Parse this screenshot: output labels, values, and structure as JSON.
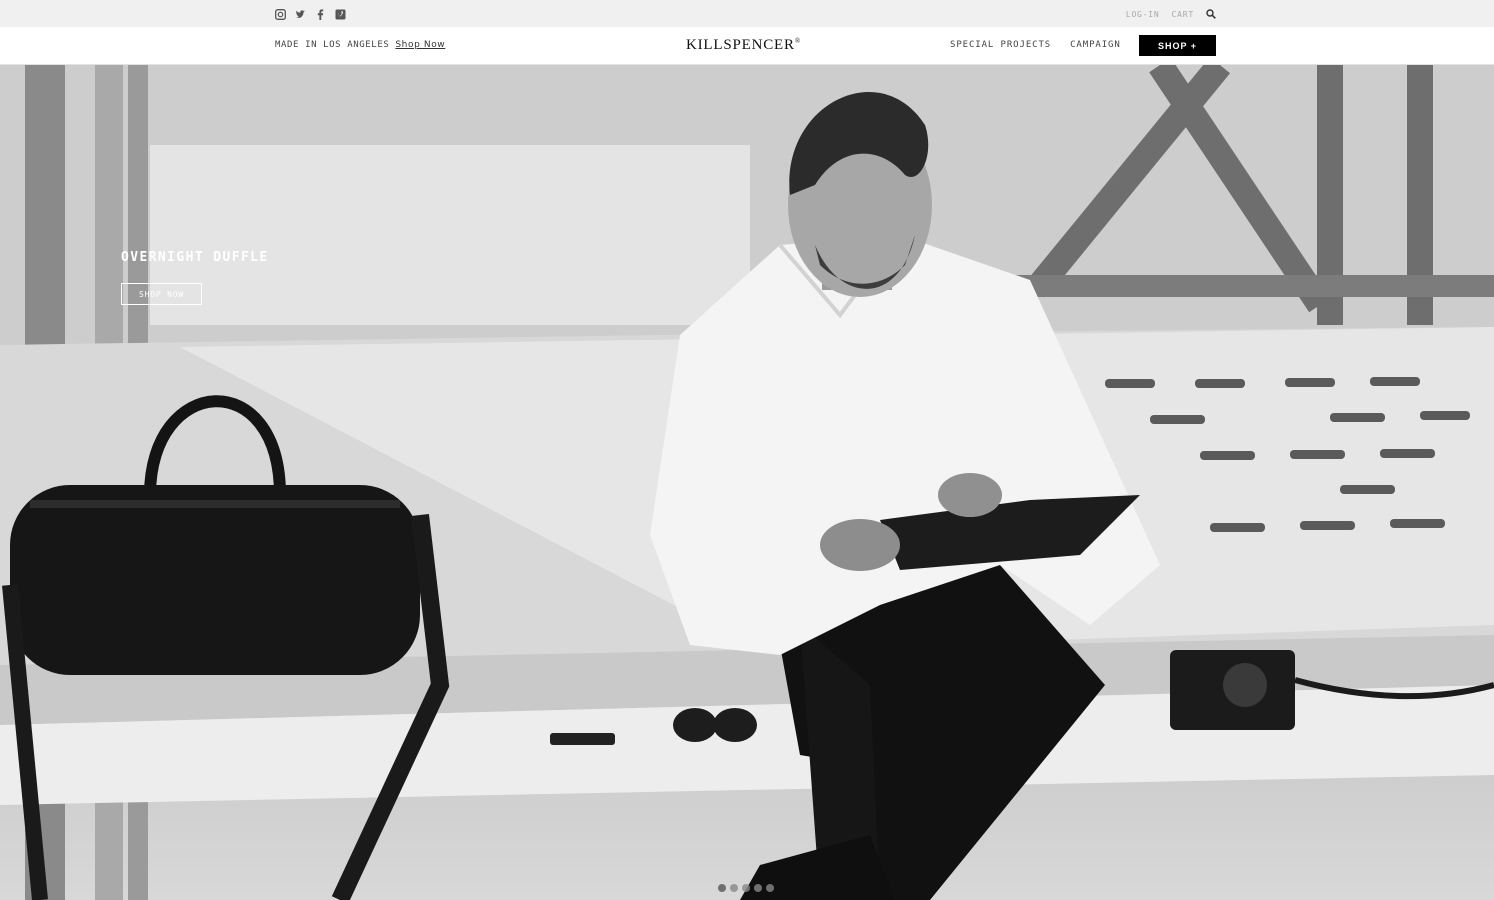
{
  "topbar": {
    "social_icons": [
      "instagram-icon",
      "twitter-icon",
      "facebook-icon",
      "vimeo-icon"
    ],
    "login": "LOG-IN",
    "cart": "CART",
    "search_icon": "search-icon"
  },
  "header": {
    "tagline": "MADE IN LOS ANGELES",
    "tagline_link": "Shop Now",
    "logo": "KILLSPENCER",
    "logo_mark": "®",
    "nav": [
      "SPECIAL PROJECTS",
      "CAMPAIGN"
    ],
    "shop_button": "SHOP +"
  },
  "hero": {
    "title": "OVERNIGHT DUFFLE",
    "cta": "SHOP NOW",
    "slides": 5,
    "active_slide": 1
  },
  "colors": {
    "topbar_bg": "#f0f0f0",
    "shop_button_bg": "#000000",
    "hero_text": "#ffffff"
  }
}
